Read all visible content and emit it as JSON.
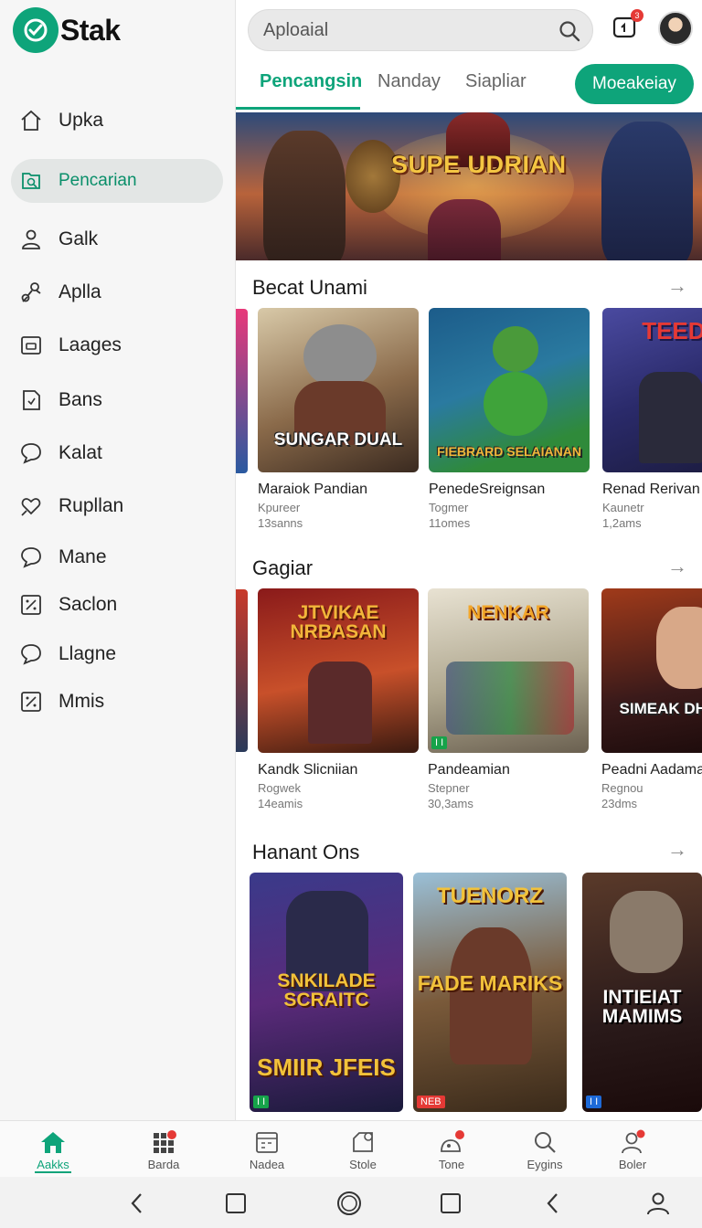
{
  "app": {
    "name": "Stak"
  },
  "search": {
    "placeholder": "Aploaial"
  },
  "header": {
    "notifications_count": "3"
  },
  "sidebar": {
    "items": [
      {
        "label": "Upka",
        "icon": "home-icon"
      },
      {
        "label": "Pencarian",
        "icon": "search-icon",
        "active": true
      },
      {
        "label": "Galk",
        "icon": "person-icon"
      },
      {
        "label": "Aplla",
        "icon": "scissors-icon"
      },
      {
        "label": "Laages",
        "icon": "frame-icon"
      },
      {
        "label": "Bans",
        "icon": "document-icon"
      },
      {
        "label": "Kalat",
        "icon": "chat-icon"
      },
      {
        "label": "Rupllan",
        "icon": "heart-icon"
      },
      {
        "label": "Mane",
        "icon": "chat-icon"
      },
      {
        "label": "Saclon",
        "icon": "percent-icon"
      },
      {
        "label": "Llagne",
        "icon": "chat-icon"
      },
      {
        "label": "Mmis",
        "icon": "percent-icon"
      }
    ]
  },
  "tabs": {
    "items": [
      "Pencangsin",
      "Nanday",
      "Siapliar"
    ],
    "cta": "Moeakeiay"
  },
  "banner": {
    "title": "SUPE UDRIAN"
  },
  "sections": [
    {
      "title": "Becat Unami",
      "cards": [
        {
          "art_title": "SUNGAR DUAL",
          "name": "Maraiok Pandian",
          "sub1": "Kpureer",
          "sub2": "13sanns"
        },
        {
          "art_title": "FIEBRARD SELAIANAN",
          "name": "PenedeSreignsan",
          "sub1": "Togmer",
          "sub2": "11omes"
        },
        {
          "art_title": "TEEDO",
          "name": "Renad Rerivan",
          "sub1": "Kaunetr",
          "sub2": "1,2ams"
        }
      ]
    },
    {
      "title": "Gagiar",
      "cards": [
        {
          "art_title": "JTVIKAE NRBASAN",
          "name": "Kandk Slicniian",
          "sub1": "Rogwek",
          "sub2": "14eamis"
        },
        {
          "art_title": "NENKAR",
          "name": "Pandeamian",
          "sub1": "Stepner",
          "sub2": "30,3ams"
        },
        {
          "art_title": "SIMEAK DHDAIK",
          "name": "Peadni Aadaman",
          "sub1": "Regnou",
          "sub2": "23dms"
        }
      ]
    },
    {
      "title": "Hanant Ons",
      "cards": [
        {
          "art_title": "SNKILADE SCRAITC",
          "art_title2": "SMIIR JFEIS"
        },
        {
          "art_title": "TUENORZ",
          "art_title2": "FADE MARIKS"
        },
        {
          "art_title": "INTIEIAT MAMIMS"
        }
      ]
    }
  ],
  "bottom_nav": [
    {
      "label": "Aakks",
      "icon": "home-icon",
      "active": true
    },
    {
      "label": "Barda",
      "icon": "grid-icon",
      "badge": true
    },
    {
      "label": "Nadea",
      "icon": "calendar-icon"
    },
    {
      "label": "Stole",
      "icon": "store-icon"
    },
    {
      "label": "Tone",
      "icon": "tag-icon",
      "badge": true
    },
    {
      "label": "Eygins",
      "icon": "search-icon"
    },
    {
      "label": "Boler",
      "icon": "person-icon",
      "badge": true
    }
  ],
  "colors": {
    "accent": "#0ea47a",
    "badge": "#e53935"
  }
}
